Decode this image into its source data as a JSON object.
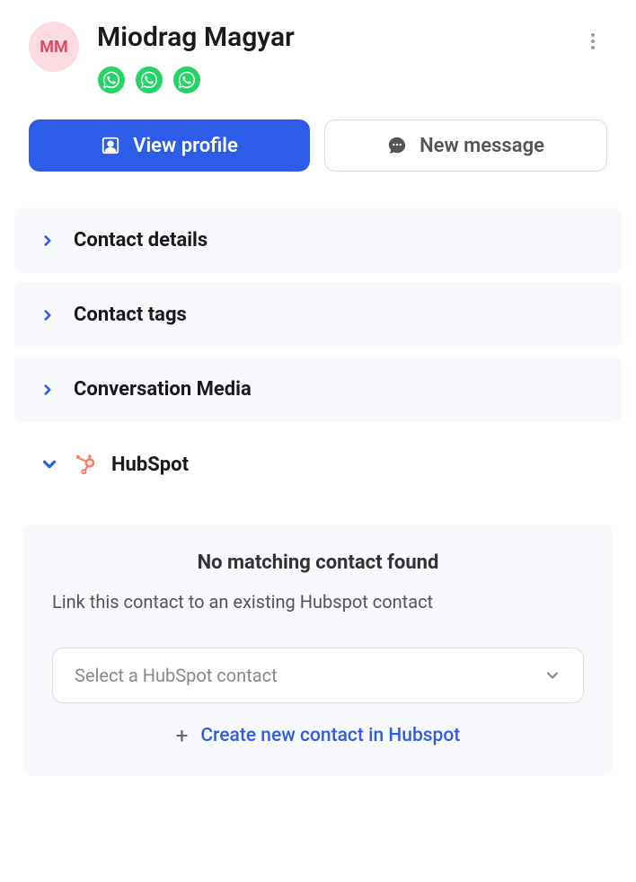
{
  "contact": {
    "initials": "MM",
    "name": "Miodrag Magyar"
  },
  "buttons": {
    "view_profile": "View profile",
    "new_message": "New message"
  },
  "sections": {
    "contact_details": "Contact details",
    "contact_tags": "Contact tags",
    "conversation_media": "Conversation Media",
    "hubspot": "HubSpot"
  },
  "hubspot_panel": {
    "title": "No matching contact found",
    "description": "Link this contact to an existing Hubspot contact",
    "select_placeholder": "Select a HubSpot contact",
    "create_link": "Create new contact in Hubspot"
  }
}
